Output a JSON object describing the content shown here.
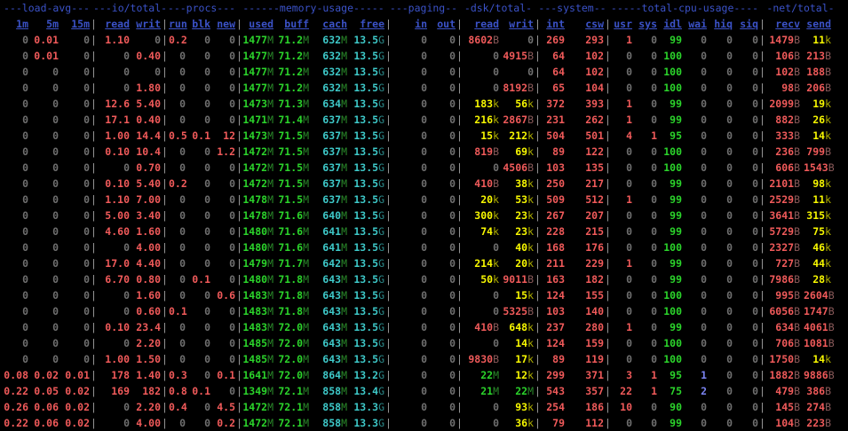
{
  "groups": [
    "---load-avg---",
    "---io/total-",
    "---procs---",
    "------memory-usage-----",
    "---paging--",
    "-dsk/total-",
    "---system--",
    "-----total-cpu-usage----",
    "-net/total-"
  ],
  "headers": [
    "1m",
    "5m",
    "15m",
    "read",
    "writ",
    "run",
    "blk",
    "new",
    "used",
    "buff",
    "cach",
    "free",
    "in",
    "out",
    "read",
    "writ",
    "int",
    "csw",
    "usr",
    "sys",
    "idl",
    "wai",
    "hiq",
    "siq",
    "recv",
    "send"
  ],
  "rows": [
    [
      "0",
      "0.01",
      "0",
      "1.10",
      "0",
      "0.2",
      "0",
      "0",
      "1477M",
      "71.2M",
      "632M",
      "13.5G",
      "0",
      "0",
      "8602B",
      "0",
      "269",
      "293",
      "1",
      "0",
      "99",
      "0",
      "0",
      "0",
      "1479B",
      "11k"
    ],
    [
      "0",
      "0.01",
      "0",
      "0",
      "0.40",
      "0",
      "0",
      "0",
      "1477M",
      "71.2M",
      "632M",
      "13.5G",
      "0",
      "0",
      "0",
      "4915B",
      "64",
      "102",
      "0",
      "0",
      "100",
      "0",
      "0",
      "0",
      "106B",
      "213B"
    ],
    [
      "0",
      "0",
      "0",
      "0",
      "0",
      "0",
      "0",
      "0",
      "1477M",
      "71.2M",
      "632M",
      "13.5G",
      "0",
      "0",
      "0",
      "0",
      "64",
      "102",
      "0",
      "0",
      "100",
      "0",
      "0",
      "0",
      "102B",
      "188B"
    ],
    [
      "0",
      "0",
      "0",
      "0",
      "1.80",
      "0",
      "0",
      "0",
      "1477M",
      "71.2M",
      "632M",
      "13.5G",
      "0",
      "0",
      "0",
      "8192B",
      "65",
      "104",
      "0",
      "0",
      "100",
      "0",
      "0",
      "0",
      "98B",
      "206B"
    ],
    [
      "0",
      "0",
      "0",
      "12.6",
      "5.40",
      "0",
      "0",
      "0",
      "1473M",
      "71.3M",
      "634M",
      "13.5G",
      "0",
      "0",
      "183k",
      "56k",
      "372",
      "393",
      "1",
      "0",
      "99",
      "0",
      "0",
      "0",
      "2099B",
      "19k"
    ],
    [
      "0",
      "0",
      "0",
      "17.1",
      "0.40",
      "0",
      "0",
      "0",
      "1471M",
      "71.4M",
      "637M",
      "13.5G",
      "0",
      "0",
      "216k",
      "2867B",
      "231",
      "262",
      "1",
      "0",
      "99",
      "0",
      "0",
      "0",
      "882B",
      "26k"
    ],
    [
      "0",
      "0",
      "0",
      "1.00",
      "14.4",
      "0.5",
      "0.1",
      "12",
      "1473M",
      "71.5M",
      "637M",
      "13.5G",
      "0",
      "0",
      "15k",
      "212k",
      "504",
      "501",
      "4",
      "1",
      "95",
      "0",
      "0",
      "0",
      "333B",
      "14k"
    ],
    [
      "0",
      "0",
      "0",
      "0.10",
      "10.4",
      "0",
      "0",
      "1.2",
      "1472M",
      "71.5M",
      "637M",
      "13.5G",
      "0",
      "0",
      "819B",
      "69k",
      "89",
      "122",
      "0",
      "0",
      "100",
      "0",
      "0",
      "0",
      "236B",
      "799B"
    ],
    [
      "0",
      "0",
      "0",
      "0",
      "0.70",
      "0",
      "0",
      "0",
      "1472M",
      "71.5M",
      "637M",
      "13.5G",
      "0",
      "0",
      "0",
      "4506B",
      "103",
      "135",
      "0",
      "0",
      "100",
      "0",
      "0",
      "0",
      "606B",
      "1543B"
    ],
    [
      "0",
      "0",
      "0",
      "0.10",
      "5.40",
      "0.2",
      "0",
      "0",
      "1472M",
      "71.5M",
      "637M",
      "13.5G",
      "0",
      "0",
      "410B",
      "38k",
      "250",
      "217",
      "0",
      "0",
      "99",
      "0",
      "0",
      "0",
      "2101B",
      "98k"
    ],
    [
      "0",
      "0",
      "0",
      "1.10",
      "7.00",
      "0",
      "0",
      "0",
      "1478M",
      "71.5M",
      "637M",
      "13.5G",
      "0",
      "0",
      "20k",
      "53k",
      "509",
      "512",
      "1",
      "0",
      "99",
      "0",
      "0",
      "0",
      "2529B",
      "11k"
    ],
    [
      "0",
      "0",
      "0",
      "5.00",
      "3.40",
      "0",
      "0",
      "0",
      "1478M",
      "71.6M",
      "640M",
      "13.5G",
      "0",
      "0",
      "300k",
      "23k",
      "267",
      "207",
      "0",
      "0",
      "99",
      "0",
      "0",
      "0",
      "3641B",
      "315k"
    ],
    [
      "0",
      "0",
      "0",
      "4.60",
      "1.60",
      "0",
      "0",
      "0",
      "1480M",
      "71.6M",
      "641M",
      "13.5G",
      "0",
      "0",
      "74k",
      "23k",
      "228",
      "215",
      "0",
      "0",
      "99",
      "0",
      "0",
      "0",
      "5729B",
      "75k"
    ],
    [
      "0",
      "0",
      "0",
      "0",
      "4.00",
      "0",
      "0",
      "0",
      "1480M",
      "71.6M",
      "641M",
      "13.5G",
      "0",
      "0",
      "0",
      "40k",
      "168",
      "176",
      "0",
      "0",
      "100",
      "0",
      "0",
      "0",
      "2327B",
      "46k"
    ],
    [
      "0",
      "0",
      "0",
      "17.0",
      "4.40",
      "0",
      "0",
      "0",
      "1479M",
      "71.7M",
      "642M",
      "13.5G",
      "0",
      "0",
      "214k",
      "20k",
      "211",
      "229",
      "1",
      "0",
      "99",
      "0",
      "0",
      "0",
      "727B",
      "44k"
    ],
    [
      "0",
      "0",
      "0",
      "6.70",
      "0.80",
      "0",
      "0.1",
      "0",
      "1480M",
      "71.8M",
      "643M",
      "13.5G",
      "0",
      "0",
      "50k",
      "9011B",
      "163",
      "182",
      "0",
      "0",
      "99",
      "0",
      "0",
      "0",
      "7986B",
      "28k"
    ],
    [
      "0",
      "0",
      "0",
      "0",
      "1.60",
      "0",
      "0",
      "0.6",
      "1483M",
      "71.8M",
      "643M",
      "13.5G",
      "0",
      "0",
      "0",
      "15k",
      "124",
      "155",
      "0",
      "0",
      "100",
      "0",
      "0",
      "0",
      "995B",
      "2604B"
    ],
    [
      "0",
      "0",
      "0",
      "0",
      "0.60",
      "0.1",
      "0",
      "0",
      "1483M",
      "71.8M",
      "643M",
      "13.5G",
      "0",
      "0",
      "0",
      "5325B",
      "103",
      "140",
      "0",
      "0",
      "100",
      "0",
      "0",
      "0",
      "6056B",
      "1747B"
    ],
    [
      "0",
      "0",
      "0",
      "0.10",
      "23.4",
      "0",
      "0",
      "0",
      "1483M",
      "72.0M",
      "643M",
      "13.5G",
      "0",
      "0",
      "410B",
      "648k",
      "237",
      "280",
      "1",
      "0",
      "99",
      "0",
      "0",
      "0",
      "634B",
      "4061B"
    ],
    [
      "0",
      "0",
      "0",
      "0",
      "2.20",
      "0",
      "0",
      "0",
      "1485M",
      "72.0M",
      "643M",
      "13.5G",
      "0",
      "0",
      "0",
      "14k",
      "124",
      "159",
      "0",
      "0",
      "100",
      "0",
      "0",
      "0",
      "706B",
      "1081B"
    ],
    [
      "0",
      "0",
      "0",
      "1.00",
      "1.50",
      "0",
      "0",
      "0",
      "1485M",
      "72.0M",
      "643M",
      "13.5G",
      "0",
      "0",
      "9830B",
      "17k",
      "89",
      "119",
      "0",
      "0",
      "100",
      "0",
      "0",
      "0",
      "1750B",
      "14k"
    ],
    [
      "0.08",
      "0.02",
      "0.01",
      "178",
      "1.40",
      "0.3",
      "0",
      "0.1",
      "1641M",
      "72.0M",
      "864M",
      "13.2G",
      "0",
      "0",
      "22M",
      "12k",
      "299",
      "371",
      "3",
      "1",
      "95",
      "1",
      "0",
      "0",
      "1882B",
      "9886B"
    ],
    [
      "0.22",
      "0.05",
      "0.02",
      "169",
      "182",
      "0.8",
      "0.1",
      "0",
      "1349M",
      "72.1M",
      "858M",
      "13.4G",
      "0",
      "0",
      "21M",
      "22M",
      "543",
      "357",
      "22",
      "1",
      "75",
      "2",
      "0",
      "0",
      "479B",
      "386B"
    ],
    [
      "0.26",
      "0.06",
      "0.02",
      "0",
      "2.20",
      "0.4",
      "0",
      "4.5",
      "1472M",
      "72.1M",
      "858M",
      "13.3G",
      "0",
      "0",
      "0",
      "93k",
      "254",
      "186",
      "10",
      "0",
      "90",
      "0",
      "0",
      "0",
      "145B",
      "274B"
    ],
    [
      "0.22",
      "0.06",
      "0.02",
      "0",
      "4.00",
      "0",
      "0",
      "0.2",
      "1472M",
      "72.1M",
      "858M",
      "13.3G",
      "0",
      "0",
      "0",
      "36k",
      "79",
      "112",
      "0",
      "0",
      "99",
      "0",
      "0",
      "0",
      "104B",
      "223B"
    ]
  ]
}
